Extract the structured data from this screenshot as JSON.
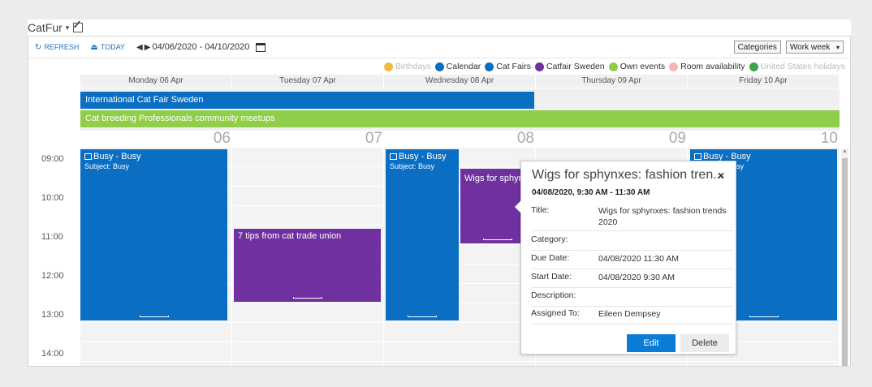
{
  "header": {
    "title": "CatFur",
    "caret": "▾"
  },
  "toolbar": {
    "refresh": "REFRESH",
    "today": "TODAY",
    "date_range": "04/06/2020 - 04/10/2020",
    "categories_label": "Categories",
    "view_select": "Work week",
    "view_caret": "▾"
  },
  "legend": [
    {
      "label": "Birthdays",
      "color": "#f3b942",
      "faded": true
    },
    {
      "label": "Calendar",
      "color": "#0a6fc2",
      "faded": false
    },
    {
      "label": "Cat Fairs",
      "color": "#0a6fc2",
      "faded": false
    },
    {
      "label": "Catfair Sweden",
      "color": "#7030a0",
      "faded": false
    },
    {
      "label": "Own events",
      "color": "#8fce48",
      "faded": false
    },
    {
      "label": "Room availability",
      "color": "#f4b6b6",
      "faded": false
    },
    {
      "label": "United States holidays",
      "color": "#3aa54a",
      "faded": true
    }
  ],
  "days": [
    {
      "header": "Monday 06 Apr",
      "num": "06"
    },
    {
      "header": "Tuesday 07 Apr",
      "num": "07"
    },
    {
      "header": "Wednesday 08 Apr",
      "num": "08"
    },
    {
      "header": "Thursday 09 Apr",
      "num": "09"
    },
    {
      "header": "Friday 10 Apr",
      "num": "10"
    }
  ],
  "allday": [
    {
      "title": "International Cat Fair Sweden",
      "color": "#0a6fc2"
    },
    {
      "title": "Cat breeding Professionals community meetups",
      "color": "#8fce48"
    }
  ],
  "times": [
    "09:00",
    "10:00",
    "11:00",
    "12:00",
    "13:00",
    "14:00"
  ],
  "events": {
    "mon": {
      "title": "Busy - Busy",
      "subject": "Subject: Busy"
    },
    "tue": {
      "title": "7 tips from cat trade union"
    },
    "wed": {
      "title": "Busy - Busy",
      "subject": "Subject: Busy"
    },
    "wigs": {
      "title": "Wigs for sphyn"
    },
    "fri": {
      "title": "Busy - Busy",
      "subject": "sy"
    }
  },
  "colors": {
    "busy": "#0a6fc2",
    "purple": "#7030a0",
    "green": "#8fce48"
  },
  "popup": {
    "title": "Wigs for sphynxes: fashion tren...",
    "close": "×",
    "datetime": "04/08/2020, 9:30 AM - 11:30 AM",
    "fields": [
      {
        "label": "Title:",
        "value": "Wigs for sphynxes: fashion trends 2020"
      },
      {
        "label": "Category:",
        "value": ""
      },
      {
        "label": "Due Date:",
        "value": "04/08/2020 11:30 AM"
      },
      {
        "label": "Start Date:",
        "value": "04/08/2020 9:30 AM"
      },
      {
        "label": "Description:",
        "value": ""
      },
      {
        "label": "Assigned To:",
        "value": "Eileen Dempsey"
      }
    ],
    "edit_label": "Edit",
    "delete_label": "Delete"
  }
}
